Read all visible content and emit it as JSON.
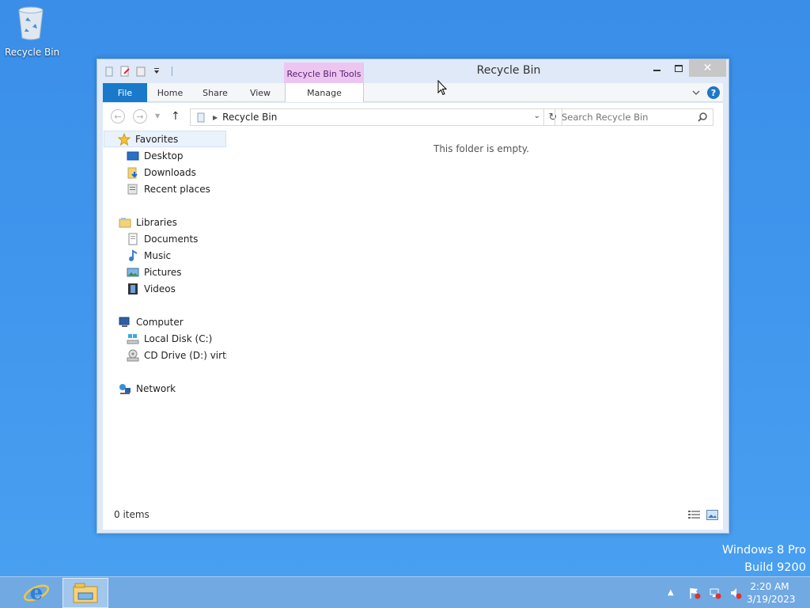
{
  "desktop": {
    "icons": [
      {
        "label": "Recycle Bin",
        "icon": "recycle-bin-icon"
      }
    ],
    "watermark": {
      "line1": "Windows 8 Pro",
      "line2": "Build 9200"
    }
  },
  "window": {
    "title": "Recycle Bin",
    "contextual_tab": "Recycle Bin Tools",
    "ribbon_tabs": {
      "file": "File",
      "home": "Home",
      "share": "Share",
      "view": "View",
      "manage": "Manage"
    },
    "help": "?",
    "address": {
      "path": "Recycle Bin"
    },
    "search": {
      "placeholder": "Search Recycle Bin"
    },
    "nav": {
      "favorites": {
        "label": "Favorites",
        "items": [
          "Desktop",
          "Downloads",
          "Recent places"
        ]
      },
      "libraries": {
        "label": "Libraries",
        "items": [
          "Documents",
          "Music",
          "Pictures",
          "Videos"
        ]
      },
      "computer": {
        "label": "Computer",
        "items": [
          "Local Disk (C:)",
          "CD Drive (D:) virtio-w"
        ]
      },
      "network": {
        "label": "Network"
      }
    },
    "empty_message": "This folder is empty.",
    "status": "0 items"
  },
  "taskbar": {
    "apps": [
      "internet-explorer-icon",
      "file-explorer-icon"
    ],
    "clock": {
      "time": "2:20 AM",
      "date": "3/19/2023"
    }
  },
  "colors": {
    "accent": "#1979ca",
    "contextual": "#ecc5f0",
    "desktop": "#3f95ec"
  }
}
